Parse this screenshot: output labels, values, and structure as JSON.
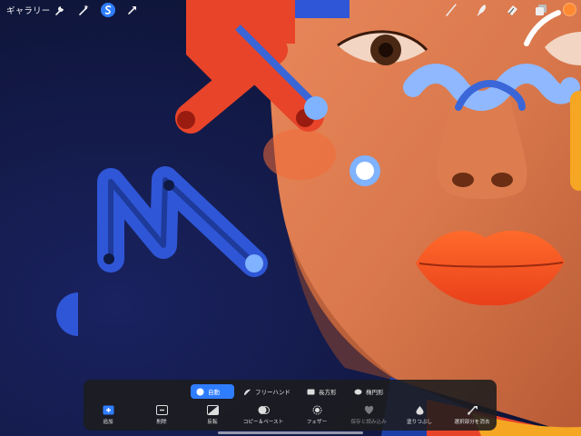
{
  "toolbar": {
    "gallery_label": "ギャラリー",
    "left_icons": [
      "wrench-icon",
      "magic-wand-icon",
      "selection-icon",
      "transform-arrow-icon"
    ],
    "right_icons": [
      "brush-icon",
      "smudge-icon",
      "eraser-icon",
      "layers-icon"
    ],
    "current_color": "#ff8a32"
  },
  "selection_panel": {
    "modes": [
      {
        "label": "自動",
        "icon": "auto-icon",
        "active": true
      },
      {
        "label": "フリーハンド",
        "icon": "freehand-icon",
        "active": false
      },
      {
        "label": "長方形",
        "icon": "rectangle-icon",
        "active": false
      },
      {
        "label": "楕円形",
        "icon": "ellipse-icon",
        "active": false
      }
    ],
    "actions": [
      {
        "label": "追加",
        "icon": "add-icon",
        "enabled": true
      },
      {
        "label": "削除",
        "icon": "remove-icon",
        "enabled": true
      },
      {
        "label": "反転",
        "icon": "invert-icon",
        "enabled": true
      },
      {
        "label": "コピー＆ペースト",
        "icon": "copy-paste-icon",
        "enabled": true
      },
      {
        "label": "フェザー",
        "icon": "feather-icon",
        "enabled": true
      },
      {
        "label": "保存と読み込み",
        "icon": "save-load-icon",
        "enabled": false
      },
      {
        "label": "塗りつぶし",
        "icon": "fill-icon",
        "enabled": true
      },
      {
        "label": "選択部分を消去",
        "icon": "clear-selection-icon",
        "enabled": true
      }
    ]
  },
  "colors": {
    "accent": "#2f7dff",
    "background": "#0f1530",
    "panel": "#1c1c1e"
  }
}
